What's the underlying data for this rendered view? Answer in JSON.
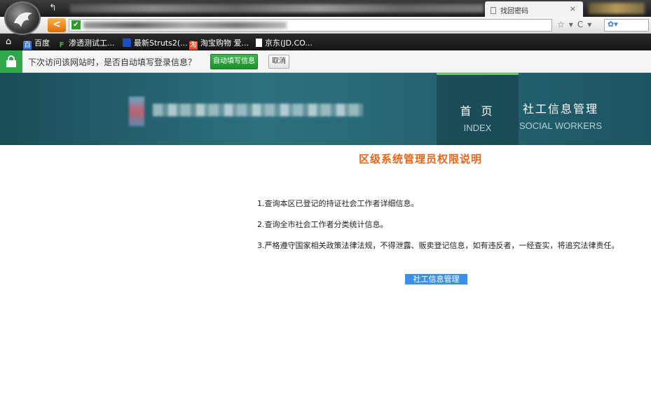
{
  "browser": {
    "tab_title": "找回密码",
    "tab_close": "×",
    "back_label": "<",
    "address_check": "✔",
    "nav_tools": [
      "☆",
      "▾",
      "C",
      "▾"
    ],
    "search_engine_icon": "paw-icon"
  },
  "bookmarks": [
    {
      "label": "百度",
      "icon": "baidu-icon",
      "color": "#2f6fd6"
    },
    {
      "label": "渗透测试工...",
      "icon": "f-icon",
      "color": "#4caf50"
    },
    {
      "label": "最新Struts2(...",
      "icon": "bookmark-icon",
      "color": "#1e4fbf"
    },
    {
      "label": "淘宝购物 爱...",
      "icon": "taobao-icon",
      "color": "#e8501e"
    },
    {
      "label": "京东(JD.CO...",
      "icon": "page-icon",
      "color": "#ffffff"
    }
  ],
  "infobar": {
    "message": "下次访问该网站时，是否自动填写登录信息？",
    "autofill_label": "自动填写信息",
    "cancel_label": "取消"
  },
  "site": {
    "nav": [
      {
        "cn": "首页",
        "en": "INDEX"
      },
      {
        "cn": "社工信息管理",
        "en": "SOCIAL WORKERS"
      }
    ]
  },
  "content": {
    "title": "区级系统管理员权限说明",
    "rules": [
      "1.查询本区已登记的持证社会工作者详细信息。",
      "2.查询全市社会工作者分类统计信息。",
      "3.严格遵守国家相关政策法律法规，不得泄露、贩卖登记信息，如有违反者，一经查实，将追究法律责任。"
    ],
    "link_label": "社工信息管理"
  },
  "colors": {
    "accent_orange": "#e8651a",
    "header_teal": "#2d7080",
    "link_blue": "#3b8fe6",
    "ok_green": "#2da84a"
  }
}
